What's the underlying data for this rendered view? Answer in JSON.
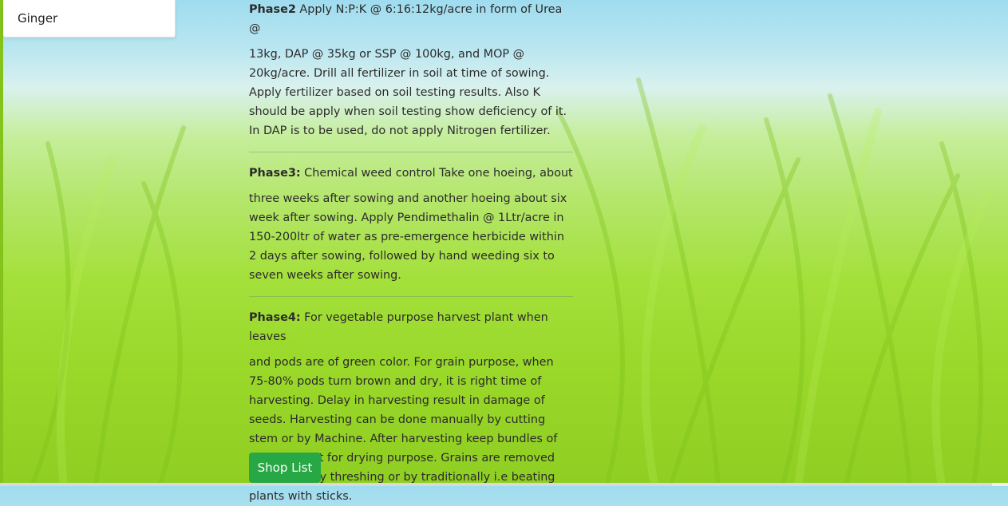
{
  "dropdown": {
    "visible_item": "Ginger"
  },
  "phases": [
    {
      "title": "Phase2",
      "first_line": " Apply N:P:K @ 6:16:12kg/acre in form of Urea @",
      "body": "13kg, DAP @ 35kg or SSP @ 100kg, and MOP @ 20kg/acre. Drill all fertilizer in soil at time of sowing. Apply fertilizer based on soil testing results. Also K should be apply when soil testing show deficiency of it. In DAP is to be used, do not apply Nitrogen fertilizer."
    },
    {
      "title": "Phase3:",
      "first_line": " Chemical weed control Take one hoeing, about",
      "body": "three weeks after sowing and another hoeing about six week after sowing. Apply Pendimethalin @ 1Ltr/acre in 150-200ltr of water as pre-emergence herbicide within 2 days after sowing, followed by hand weeding six to seven weeks after sowing."
    },
    {
      "title": "Phase4:",
      "first_line": " For vegetable purpose harvest plant when leaves",
      "body": "and pods are of green color. For grain purpose, when 75-80% pods turn brown and dry, it is right time of harvesting. Delay in harvesting result in damage of seeds. Harvesting can be done manually by cutting stem or by Machine. After harvesting keep bundles of plant upright for drying purpose. Grains are removed from plant by threshing or by traditionally i.e beating plants with sticks."
    }
  ],
  "shop_button": {
    "label": "Shop List",
    "color": "#28a745"
  }
}
